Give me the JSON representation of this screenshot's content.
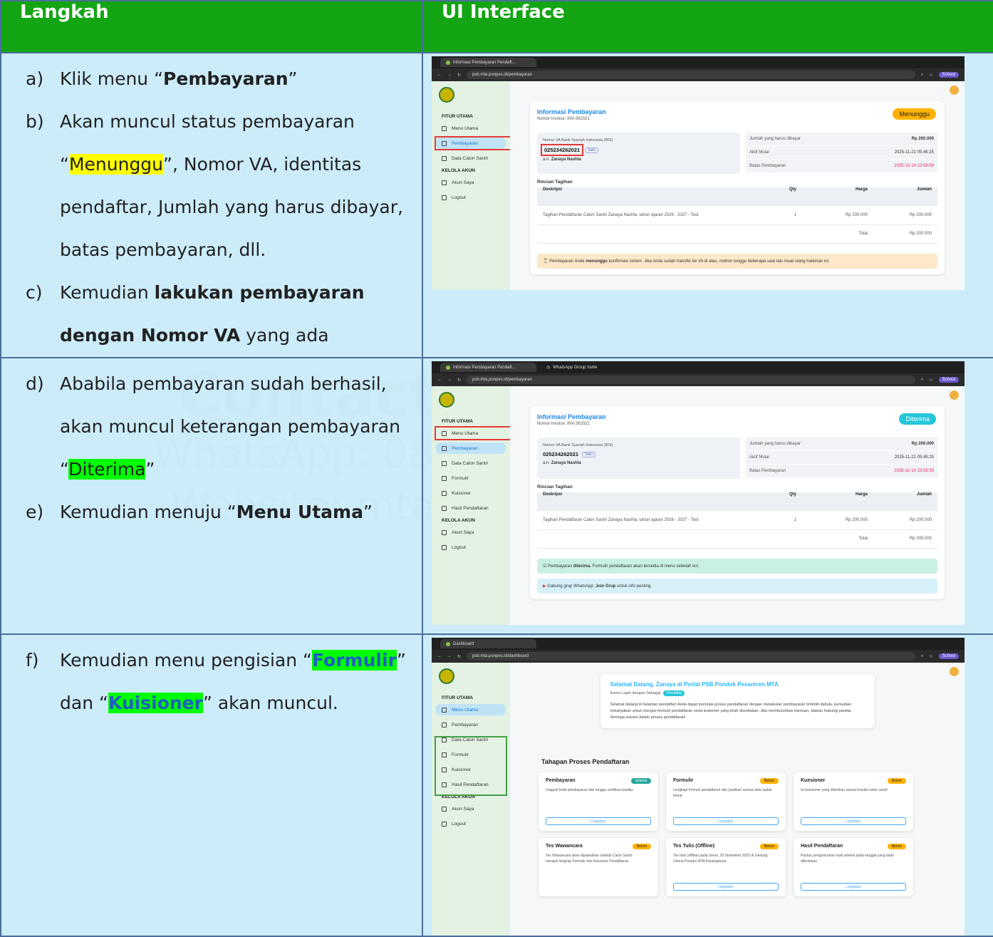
{
  "watermark": {
    "line1": "Contact",
    "line2": "WhatsApp: 08",
    "line3": "Website: mta.p"
  },
  "header": {
    "col1": "Langkah",
    "col2": "UI Interface"
  },
  "steps": {
    "a": {
      "label": "a)",
      "pre": "Klik menu “",
      "bold": "Pembayaran",
      "post": "”"
    },
    "b": {
      "label": "b)",
      "line1": "Akan muncul status pembayaran",
      "q_open": "“",
      "hl": "Menunggu",
      "line2_rest": "”, Nomor VA, identitas",
      "line3": "pendaftar, Jumlah yang harus dibayar,",
      "line4": "batas pembayaran, dll."
    },
    "c": {
      "label": "c)",
      "pre": "Kemudian ",
      "bold1": "lakukan pembayaran",
      "bold2": "dengan Nomor VA",
      "post": " yang ada"
    },
    "d": {
      "label": "d)",
      "line1": "Ababila pembayaran sudah berhasil,",
      "line2": "akan muncul keterangan pembayaran",
      "q_open": "“",
      "hl": "Diterima",
      "q_close": "”"
    },
    "e": {
      "label": "e)",
      "pre": "Kemudian menuju “",
      "bold": "Menu Utama",
      "post": "”"
    },
    "f": {
      "label": "f)",
      "pre": "Kemudian menu pengisian “",
      "hl1": "Formulir",
      "mid": "”",
      "line2_pre": "dan “",
      "hl2": "Kuisioner",
      "line2_post": "” akan muncul."
    }
  },
  "browser": {
    "tab_payment": "Informasi Pembayaran Pendaft...",
    "tab_wa": "WhatsApp Group Invite",
    "tab_dash": "Dashboard",
    "url_payment": "psb.mta.ponpes.id/pembayaran",
    "url_dash": "psb.mta.ponpes.id/dashboard",
    "profile": "School"
  },
  "sidebar": {
    "sec1": "FITUR UTAMA",
    "sec2": "KELOLA AKUN",
    "menu_utama": "Menu Utama",
    "pembayaran": "Pembayaran",
    "data_calon": "Data Calon Santri",
    "formulir": "Formulir",
    "kuisioner": "Kuisioner",
    "hasil": "Hasil Pendaftaran",
    "akun": "Akun Saya",
    "logout": "Logout"
  },
  "payment": {
    "title": "Informasi Pembayaran",
    "invoice": "Nomor Invoice: INV-262021",
    "status_wait": "Menunggu",
    "status_ok": "Diterima",
    "va_label": "Nomor VA Bank Syariah Indonesia (BSI)",
    "va_number": "025234262021",
    "salin": "Salin",
    "va_name_pre": "a.n. ",
    "va_name": "Zanaya Nashla",
    "kv": [
      {
        "k": "Jumlah yang harus dibayar",
        "v": "Rp 200.000"
      },
      {
        "k": "Aktif Mulai",
        "v": "2025-11-21 05:45:25"
      },
      {
        "k": "Batas Pembayaran",
        "v": "2025-12-14 23:59:59"
      }
    ],
    "rincian": "Rincian Tagihan",
    "cols": {
      "desc": "Deskripsi",
      "qty": "Qty",
      "harga": "Harga",
      "jumlah": "Jumlah"
    },
    "item": {
      "desc": "Tagihan Pendaftaran Calon Santri Zanaya Nashla, tahun ajaran 2026 - 2027 - Test",
      "qty": "1",
      "harga": "Rp 200.000",
      "jumlah": "Rp 200.000"
    },
    "total_label": "Total",
    "total": "Rp 200.000",
    "alert_wait_pre": "⏳ Pembayaran Anda ",
    "alert_wait_bold": "menunggu",
    "alert_wait_post": " konfirmasi sistem. Jika Anda sudah transfer ke VA di atas, mohon tunggu beberapa saat lalu muat ulang halaman ini.",
    "alert_ok_pre": "☑ Pembayaran ",
    "alert_ok_bold": "diterima.",
    "alert_ok_post": " Formulir pendaftaran akan tersedia di menu sebelah kiri.",
    "alert_wa_pre": "Gabung grup WhatsApp: ",
    "alert_wa_bold": "Join Grup",
    "alert_wa_post": " untuk info penting."
  },
  "dashboard": {
    "title": "Selamat Datang, Zanaya di Portal PSB Pondok Pesantren MTA",
    "login_as": "Kamu Login dengan Sebagai",
    "role": "Pendaftar",
    "intro": "Selamat datang di halaman pendaftar! Anda dapat memulai proses pendaftaran dengan melakukan pembayaran terlebih dahulu, kemudian melanjutkan untuk mengisi formulir pendaftaran serta kuisioner yang telah disediakan. Jika membutuhkan bantuan, silakan hubungi panitia. Semoga sukses dalam proses pendaftaran!",
    "tahapan": "Tahapan Proses Pendaftaran",
    "lanjutkan": "Lanjutkan",
    "cards": [
      {
        "name": "Pembayaran",
        "status": "Selesai",
        "desc": "Unggah bukti pembayaran dan tunggu verifikasi panitia."
      },
      {
        "name": "Formulir",
        "status": "Belum",
        "desc": "Lengkapi formulir pendaftaran dan pastikan semua data sudah benar."
      },
      {
        "name": "Kuesioner",
        "status": "Belum",
        "desc": "Isi kuesioner yang diberikan sesuai kondisi calon santri."
      },
      {
        "name": "Tes Wawancara",
        "status": "Belum",
        "desc": "Tes Wawancara akan dijadwalkan setelah Calon Santri mengisi lengkap Formulir dan Kuisioner Pendaftaran."
      },
      {
        "name": "Tes Tulis (Offline)",
        "status": "Belum",
        "desc": "Tes tulis (offline) pada Senin, 29 Desember 2025 di Gedung Utama Ponpes MTA Karanganyar."
      },
      {
        "name": "Hasil Pendaftaran",
        "status": "Belum",
        "desc": "Pantau pengumuman hasil seleksi pada tanggal yang telah ditentukan."
      }
    ]
  }
}
